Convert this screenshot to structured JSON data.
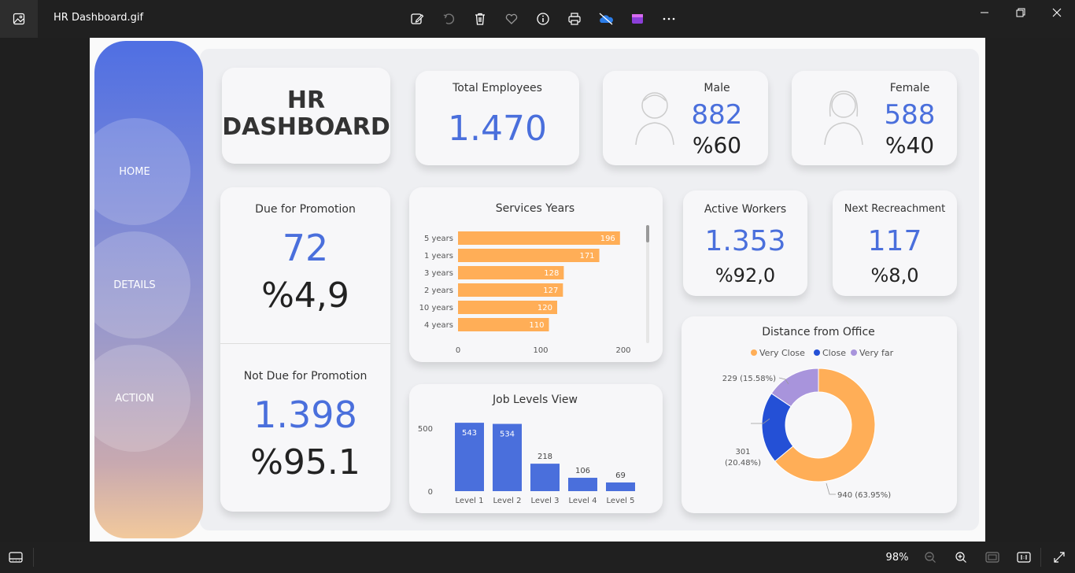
{
  "window": {
    "title": "HR Dashboard.gif",
    "zoom": "98%"
  },
  "toolbar": {
    "icons": [
      "edit-image-icon",
      "rotate-icon",
      "delete-icon",
      "favorite-icon",
      "info-icon",
      "print-icon",
      "onedrive-icon",
      "clipchamp-icon",
      "more-icon"
    ]
  },
  "nav": {
    "home": "HOME",
    "details": "DETAILS",
    "action": "ACTION"
  },
  "dashboard": {
    "title_line1": "HR",
    "title_line2": "DASHBOARD",
    "total_employees": {
      "label": "Total Employees",
      "value": "1.470"
    },
    "male": {
      "label": "Male",
      "value": "882",
      "pct": "%60"
    },
    "female": {
      "label": "Female",
      "value": "588",
      "pct": "%40"
    },
    "due_promotion": {
      "label": "Due for Promotion",
      "value": "72",
      "pct": "%4,9"
    },
    "not_due_promotion": {
      "label": "Not Due for Promotion",
      "value": "1.398",
      "pct": "%95.1"
    },
    "active_workers": {
      "label": "Active Workers",
      "value": "1.353",
      "pct": "%92,0"
    },
    "next_recreachment": {
      "label": "Next Recreachment",
      "value": "117",
      "pct": "%8,0"
    },
    "colors": {
      "accent_blue": "#4a6fdc",
      "bar_orange": "#ffae57",
      "dark_blue": "#2450d6",
      "lavender": "#a894dc"
    }
  },
  "chart_data": [
    {
      "type": "bar",
      "orientation": "horizontal",
      "title": "Services Years",
      "categories": [
        "5 years",
        "1 years",
        "3 years",
        "2 years",
        "10 years",
        "4 years"
      ],
      "values": [
        196,
        171,
        128,
        127,
        120,
        110
      ],
      "xlim": [
        0,
        200
      ],
      "xticks": [
        "0",
        "100",
        "200"
      ]
    },
    {
      "type": "bar",
      "title": "Job Levels View",
      "categories": [
        "Level 1",
        "Level 2",
        "Level 3",
        "Level 4",
        "Level 5"
      ],
      "values": [
        543,
        534,
        218,
        106,
        69
      ],
      "ylim": [
        0,
        600
      ],
      "yticks": [
        "0",
        "500"
      ]
    },
    {
      "type": "pie",
      "title": "Distance from Office",
      "legend": [
        "Very Close",
        "Close",
        "Very far"
      ],
      "values": [
        940,
        301,
        229
      ],
      "labels": [
        "940 (63.95%)",
        "301 (20.48%)",
        "229 (15.58%)"
      ],
      "colors": [
        "#ffae57",
        "#2450d6",
        "#a894dc"
      ]
    }
  ]
}
